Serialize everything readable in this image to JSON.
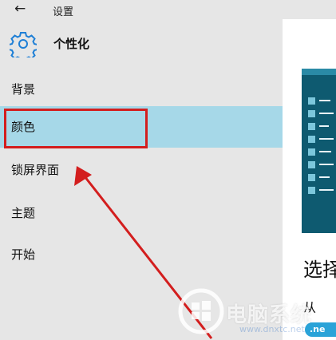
{
  "window": {
    "back_glyph": "←",
    "title": "设置"
  },
  "header": {
    "title": "个性化",
    "icon": "gear-icon"
  },
  "sidebar": {
    "items": [
      {
        "label": "背景",
        "selected": false
      },
      {
        "label": "颜色",
        "selected": true
      },
      {
        "label": "锁屏界面",
        "selected": false
      },
      {
        "label": "主题",
        "selected": false
      },
      {
        "label": "开始",
        "selected": false
      }
    ]
  },
  "content": {
    "heading": "选择",
    "cutoff_text": "从",
    "badge": ".ne"
  },
  "watermark": {
    "text": "电脑系统",
    "url": "www.dnxtc.net"
  },
  "colors": {
    "selected_bg": "#a6d8e8",
    "accent_preview": "#0e5a70",
    "annotation_red": "#d31e1e",
    "gear_blue": "#1e7fd6"
  }
}
